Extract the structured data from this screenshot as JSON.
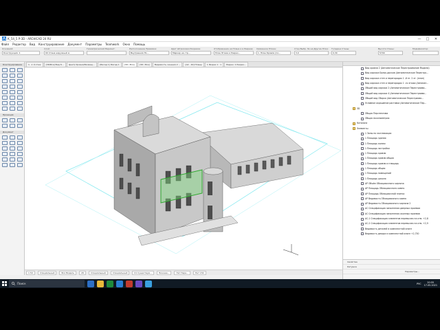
{
  "window": {
    "title": "К_54_5 Р-3D - ARCHICAD 24 RU",
    "controls": [
      "—",
      "□",
      "✕"
    ]
  },
  "menu": [
    "Файл",
    "Редактор",
    "Вид",
    "Конструирование",
    "Документ",
    "Параметры",
    "Teamwork",
    "Окно",
    "Помощь"
  ],
  "infobox": {
    "groups": [
      {
        "label": "Основной:",
        "value": "Конструкция: 1"
      },
      {
        "label": "Слой:",
        "value": "00 Стена наружный ж"
      },
      {
        "label": "Геометрический Вариант:",
        "value": ""
      },
      {
        "label": "Расположение Привязки:",
        "value": "Внутренняя По..."
      },
      {
        "label": "Цвет Штриховки Разрезов:",
        "value": "Маркер на стр..."
      },
      {
        "label": "Отображение на Плане и в Разрезе:",
        "value": "План Этажа и Разрез..."
      },
      {
        "label": "Связанное Этаже:",
        "value": "1. План Кровли (Со..."
      },
      {
        "label": "Стен Выбр. Эк на Другие Этаж:",
        "value": "3,0"
      },
      {
        "label": "Толщина Стены:",
        "value": "0,30"
      },
      {
        "label": "Высота Стены:",
        "value": "5700"
      },
      {
        "label": "Модификатор:",
        "value": ""
      }
    ]
  },
  "tabs": [
    "1. -1 й этаж",
    "[3D/Все] Вид К...",
    "Центр Уровня/Размещ...",
    "[Фасад 1] Фасад 1",
    "[3D / Все]",
    "[3D / Все]",
    "Видимость сечения 2 ...",
    "[A2 - 40] Планы",
    "1 Разрез 1 : 1",
    "Разрез: 1 Разрез..."
  ],
  "toolbox": {
    "sections": [
      "Конструирование",
      "Проекция",
      "Документ"
    ]
  },
  "nav": {
    "items": [
      {
        "label": "Вид кровли 2 (Автоматическое Перестраивание Модели)",
        "type": "view"
      },
      {
        "label": "Вид каркаса Балок-дисков (Автоматическое Перестро...",
        "type": "view"
      },
      {
        "label": "Вид каркаса стен и перегородок 1 -й эт. 2 эт. (план)",
        "type": "view"
      },
      {
        "label": "Вид каркаса стен и перегородок 1 -го этажа (Автомат...",
        "type": "view"
      },
      {
        "label": "Общий вид каркаса 2 (Автоматическое Перестраива...",
        "type": "view"
      },
      {
        "label": "Общий вид каркаса 4 (Автоматическое Перестраива...",
        "type": "view"
      },
      {
        "label": "Общий вид Сборка (Автоматическое Перестраива...",
        "type": "view"
      },
      {
        "label": "Условное окрашение раставка (Автоматическое Пер...",
        "type": "view"
      },
      {
        "label": "3D",
        "type": "folder"
      },
      {
        "label": "Общая Перспектива",
        "type": "view"
      },
      {
        "label": "Общая Аксонометрия",
        "type": "view"
      },
      {
        "label": "Каталоги",
        "type": "folder"
      },
      {
        "label": "Элементы",
        "type": "folder"
      },
      {
        "label": "1 Зоны по экспликации",
        "type": "view"
      },
      {
        "label": "1 Площадь здания",
        "type": "view"
      },
      {
        "label": "1 Площадь жилая",
        "type": "view"
      },
      {
        "label": "1 Площадь застройки",
        "type": "view"
      },
      {
        "label": "1 Площадь кровли",
        "type": "view"
      },
      {
        "label": "1 Площадь кровли общая",
        "type": "view"
      },
      {
        "label": "1 Площадь кровли и площадь",
        "type": "view"
      },
      {
        "label": "1 Площадь общая",
        "type": "view"
      },
      {
        "label": "1 Площадь помещений",
        "type": "view"
      },
      {
        "label": "1 Площадь цоколя",
        "type": "view"
      },
      {
        "label": "АР Объём Облицовочного кирпича",
        "type": "view"
      },
      {
        "label": "АР Площадь Облицовочного камня",
        "type": "view"
      },
      {
        "label": "АР Площадь Облицовочной плитки",
        "type": "view"
      },
      {
        "label": "АР Ведомость Облицовочного камня",
        "type": "view"
      },
      {
        "label": "АР Ведомость Облицовочного кирпича 2",
        "type": "view"
      },
      {
        "label": "АС Спецификация заполнения дверных проемов",
        "type": "view"
      },
      {
        "label": "АС Спецификация заполнения оконных проемов",
        "type": "view"
      },
      {
        "label": "АС-1 Спецификация элементов перемычек на отм. +2,8",
        "type": "view"
      },
      {
        "label": "АС-2 Спецификация элементов перемычек на отм. +2,9",
        "type": "view"
      },
      {
        "label": "Ведомость деталей в комплектной книге",
        "type": "view"
      },
      {
        "label": "Ведомость декора в комплектной книге +2,730",
        "type": "view"
      }
    ],
    "bottom": [
      "Свойства",
      "Катушка",
      "Параметры..."
    ]
  },
  "viewport_status": [
    "1:50",
    "Специальный",
    "Вся Модель",
    "2К",
    "Специальный",
    "Специальный",
    "01 Существую...",
    "Нижнее...",
    "Нет Пере...",
    "Нет 150"
  ],
  "taskbar": {
    "search_placeholder": "Поиск",
    "time": "20:55",
    "date": "17.05.2021",
    "lang": "РУС"
  },
  "watermark": "GRAPHISOFT ID"
}
